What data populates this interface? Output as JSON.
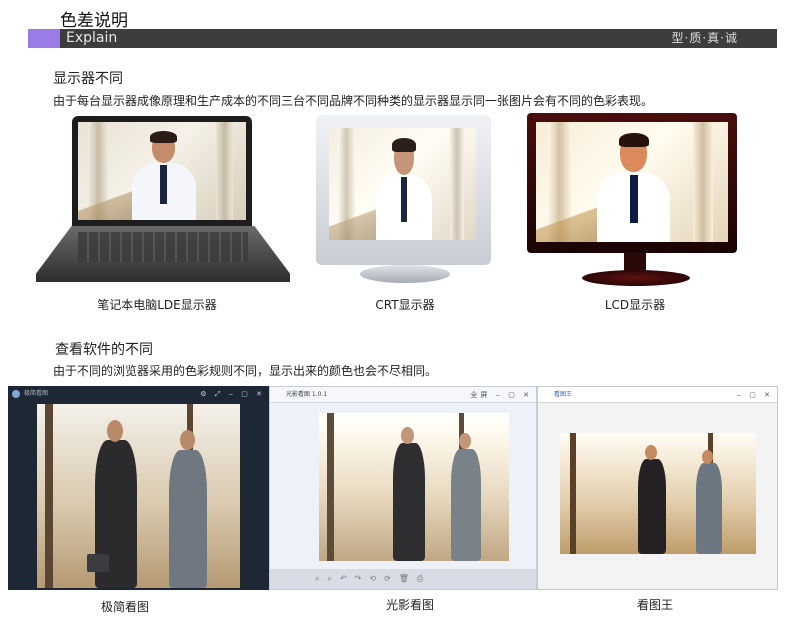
{
  "header": {
    "title": "色差说明",
    "subtitle_en": "Explain",
    "slogan": "型·质·真·诚",
    "accent_color": "#9b7be6",
    "bar_color": "#3d3d3d"
  },
  "section1": {
    "heading": "显示器不同",
    "text": "由于每台显示器成像原理和生产成本的不同三台不同品牌不同种类的显示器显示同一张图片会有不同的色彩表现。",
    "devices": [
      {
        "caption": "笔记本电脑LDE显示器",
        "icon": "laptop-icon"
      },
      {
        "caption": "CRT显示器",
        "icon": "crt-monitor-icon"
      },
      {
        "caption": "LCD显示器",
        "icon": "lcd-monitor-icon"
      }
    ]
  },
  "section2": {
    "heading": "查看软件的不同",
    "text": "由于不同的浏览器采用的色彩规则不同，显示出来的颜色也会不尽相同。",
    "viewers": [
      {
        "caption": "极简看图",
        "window_title": "极简看图",
        "window_controls": "⚙ ⤢ ‒ ▢ ✕"
      },
      {
        "caption": "光影看图",
        "window_title": "光影看图 1.0.1",
        "window_controls": "全屏 ‒ ▢ ✕"
      },
      {
        "caption": "看图王",
        "window_title": "看图王",
        "window_controls": "‒ ▢ ✕"
      }
    ]
  }
}
